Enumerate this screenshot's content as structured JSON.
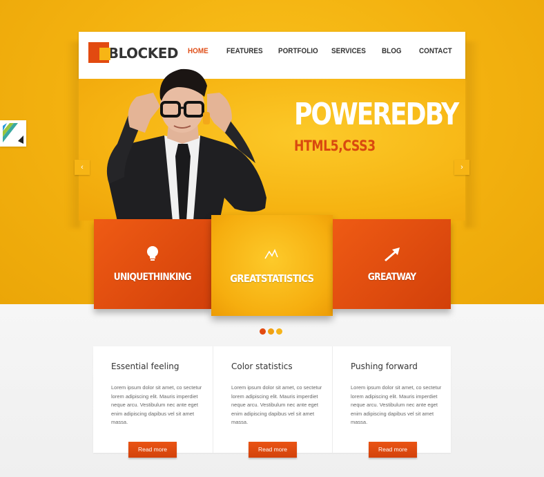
{
  "logo": {
    "text": "BLOCKED"
  },
  "nav": {
    "items": [
      {
        "label": "HOME",
        "active": true
      },
      {
        "label": "FEATURES"
      },
      {
        "label": "PORTFOLIO"
      },
      {
        "label": "SERVICES"
      },
      {
        "label": "BLOG"
      },
      {
        "label": "CONTACT"
      }
    ]
  },
  "hero": {
    "title": "POWEREDBY",
    "subtitle": "HTML5,CSS3",
    "prev_icon": "chevron-left-icon",
    "next_icon": "chevron-right-icon"
  },
  "features": [
    {
      "label": "UNIQUETHINKING",
      "icon": "lightbulb-icon"
    },
    {
      "label": "GREATSTATISTICS",
      "icon": "chart-line-icon"
    },
    {
      "label": "GREATWAY",
      "icon": "arrow-up-right-icon"
    }
  ],
  "slider_dots": {
    "count": 3,
    "active_index": 0
  },
  "cards": [
    {
      "title": "Essential feeling",
      "text": "Lorem ipsum dolor sit amet, co sectetur lorem adipiscing elit. Mauris imperdiet neque arcu. Vestibulum nec ante eget enim adipiscing dapibus vel sit amet massa.",
      "button": "Read more"
    },
    {
      "title": "Color statistics",
      "text": "Lorem ipsum dolor sit amet, co sectetur lorem adipiscing elit. Mauris imperdiet neque arcu. Vestibulum nec ante eget enim adipiscing dapibus vel sit amet massa.",
      "button": "Read more"
    },
    {
      "title": "Pushing forward",
      "text": "Lorem ipsum dolor sit amet, co sectetur lorem adipiscing elit. Mauris imperdiet neque arcu. Vestibulum nec ante eget enim adipiscing dapibus vel sit amet massa.",
      "button": "Read more"
    }
  ],
  "colors": {
    "accent_orange": "#e24a10",
    "accent_yellow": "#f7b515",
    "background_yellow": "#f3b10f"
  }
}
